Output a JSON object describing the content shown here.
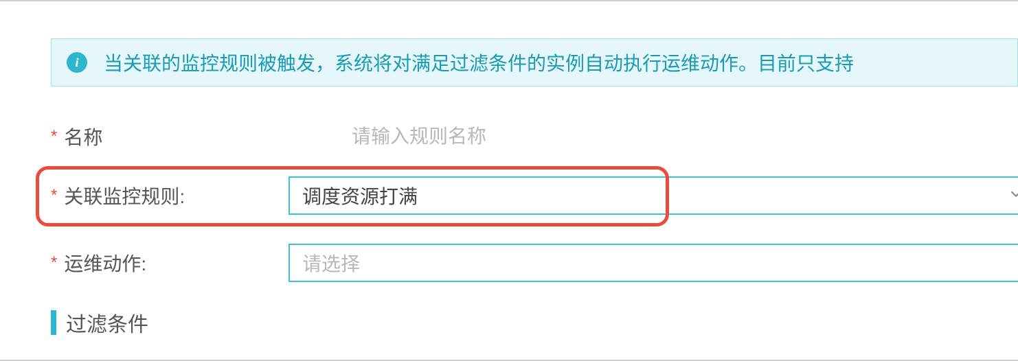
{
  "banner": {
    "text": "当关联的监控规则被触发，系统将对满足过滤条件的实例自动执行运维动作。目前只支持"
  },
  "form": {
    "name": {
      "label": "名称",
      "placeholder": "请输入规则名称",
      "value": ""
    },
    "monitorRule": {
      "label": "关联监控规则:",
      "value": "调度资源打满"
    },
    "opsAction": {
      "label": "运维动作:",
      "placeholder": "请选择",
      "value": ""
    }
  },
  "section": {
    "filterTitle": "过滤条件"
  }
}
